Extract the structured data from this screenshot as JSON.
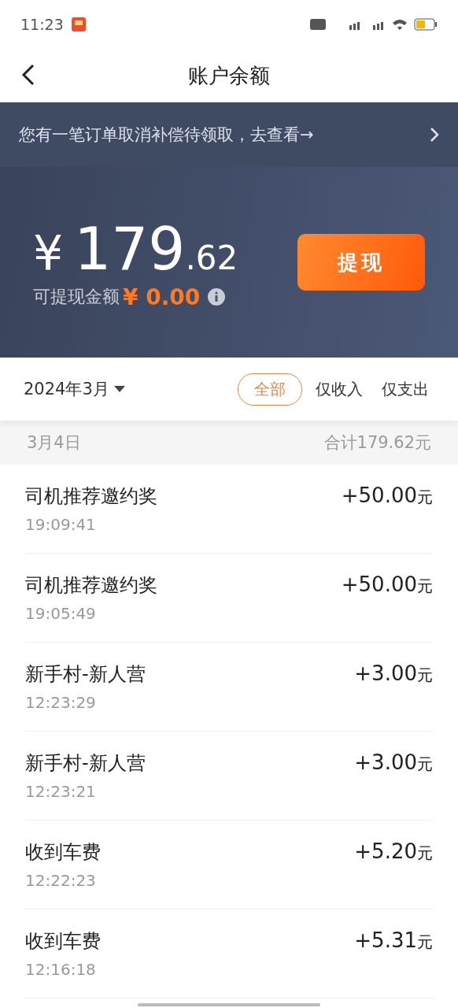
{
  "status_bar": {
    "time": "11:23"
  },
  "header": {
    "title": "账户余额"
  },
  "notice": {
    "text": "您有一笔订单取消补偿待领取，去查看→"
  },
  "balance": {
    "currency": "¥",
    "integer": "179",
    "decimal": ".62",
    "available_label": "可提现金额",
    "available_value": "¥ 0.00",
    "withdraw_button": "提现"
  },
  "filter": {
    "month": "2024年3月",
    "tabs": [
      {
        "label": "全部",
        "selected": true
      },
      {
        "label": "仅收入",
        "selected": false
      },
      {
        "label": "仅支出",
        "selected": false
      }
    ]
  },
  "day": {
    "date": "3月4日",
    "total": "合计179.62元"
  },
  "transactions": [
    {
      "title": "司机推荐邀约奖",
      "time": "19:09:41",
      "amount": "+50.00",
      "unit": "元"
    },
    {
      "title": "司机推荐邀约奖",
      "time": "19:05:49",
      "amount": "+50.00",
      "unit": "元"
    },
    {
      "title": "新手村-新人营",
      "time": "12:23:29",
      "amount": "+3.00",
      "unit": "元"
    },
    {
      "title": "新手村-新人营",
      "time": "12:23:21",
      "amount": "+3.00",
      "unit": "元"
    },
    {
      "title": "收到车费",
      "time": "12:22:23",
      "amount": "+5.20",
      "unit": "元"
    },
    {
      "title": "收到车费",
      "time": "12:16:18",
      "amount": "+5.31",
      "unit": "元"
    }
  ]
}
